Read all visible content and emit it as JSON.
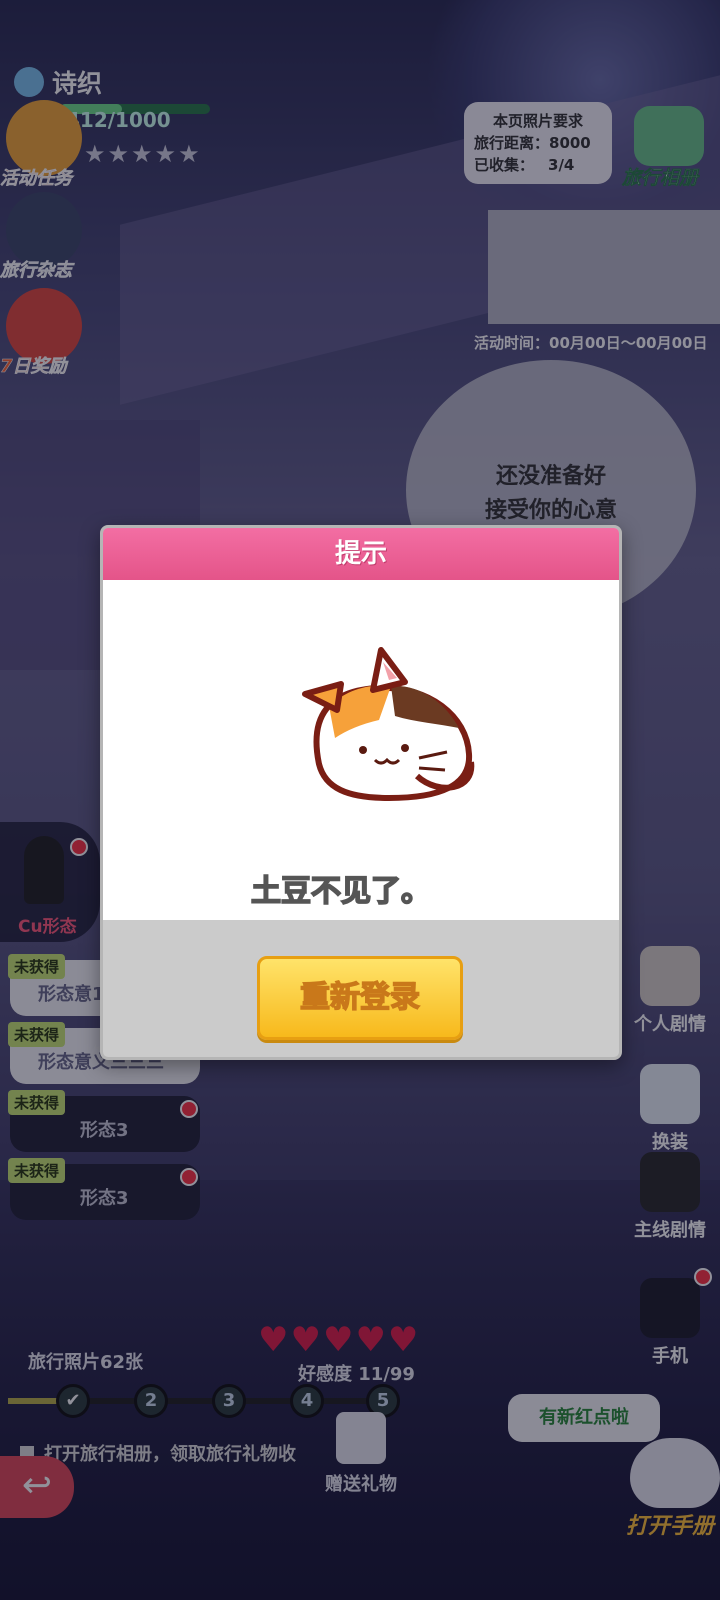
{
  "player": {
    "name": "诗织",
    "exp_text": "412/1000",
    "exp_fraction": 0.412,
    "stars_total": 5
  },
  "left_menu": {
    "activity_tasks": "活动任务",
    "travel_magazine": "旅行杂志",
    "seven_day_reward": "7日奖励"
  },
  "photo_requirement": {
    "title": "本页照片要求",
    "distance_label": "旅行距离：8000",
    "collected_label": "已收集：",
    "collected_value": "3/4"
  },
  "travel_album": "旅行相册",
  "event_time": "活动时间：00月00日～00月00日",
  "speech_bubble": {
    "line1": "还没准备好",
    "line2": "接受你的心意"
  },
  "forms": {
    "current_label": "Cu形态",
    "rows": [
      {
        "badge": "未获得",
        "name": "形态意1"
      },
      {
        "badge": "未获得",
        "name": "形态意义三三三"
      },
      {
        "badge": "未获得",
        "name": "形态3"
      },
      {
        "badge": "未获得",
        "name": "形态3"
      }
    ]
  },
  "right_menu": {
    "personal_story": "个人剧情",
    "dress_up": "换装",
    "main_story": "主线剧情",
    "phone": "手机"
  },
  "travel_photos": "旅行照片62张",
  "affection": {
    "label": "好感度 11/99",
    "hearts": 5
  },
  "progress_nodes": [
    "2",
    "3",
    "4",
    "5"
  ],
  "album_tip": "打开旅行相册，领取旅行礼物收",
  "send_gift": "赠送礼物",
  "new_red_dot": "有新红点啦",
  "open_manual": "打开手册",
  "dialog": {
    "title": "提示",
    "message": "土豆不见了。",
    "button": "重新登录"
  },
  "colors": {
    "dialog_header": "#ec5f95",
    "button_yellow": "#f7b91c",
    "heart": "#e0204a"
  }
}
